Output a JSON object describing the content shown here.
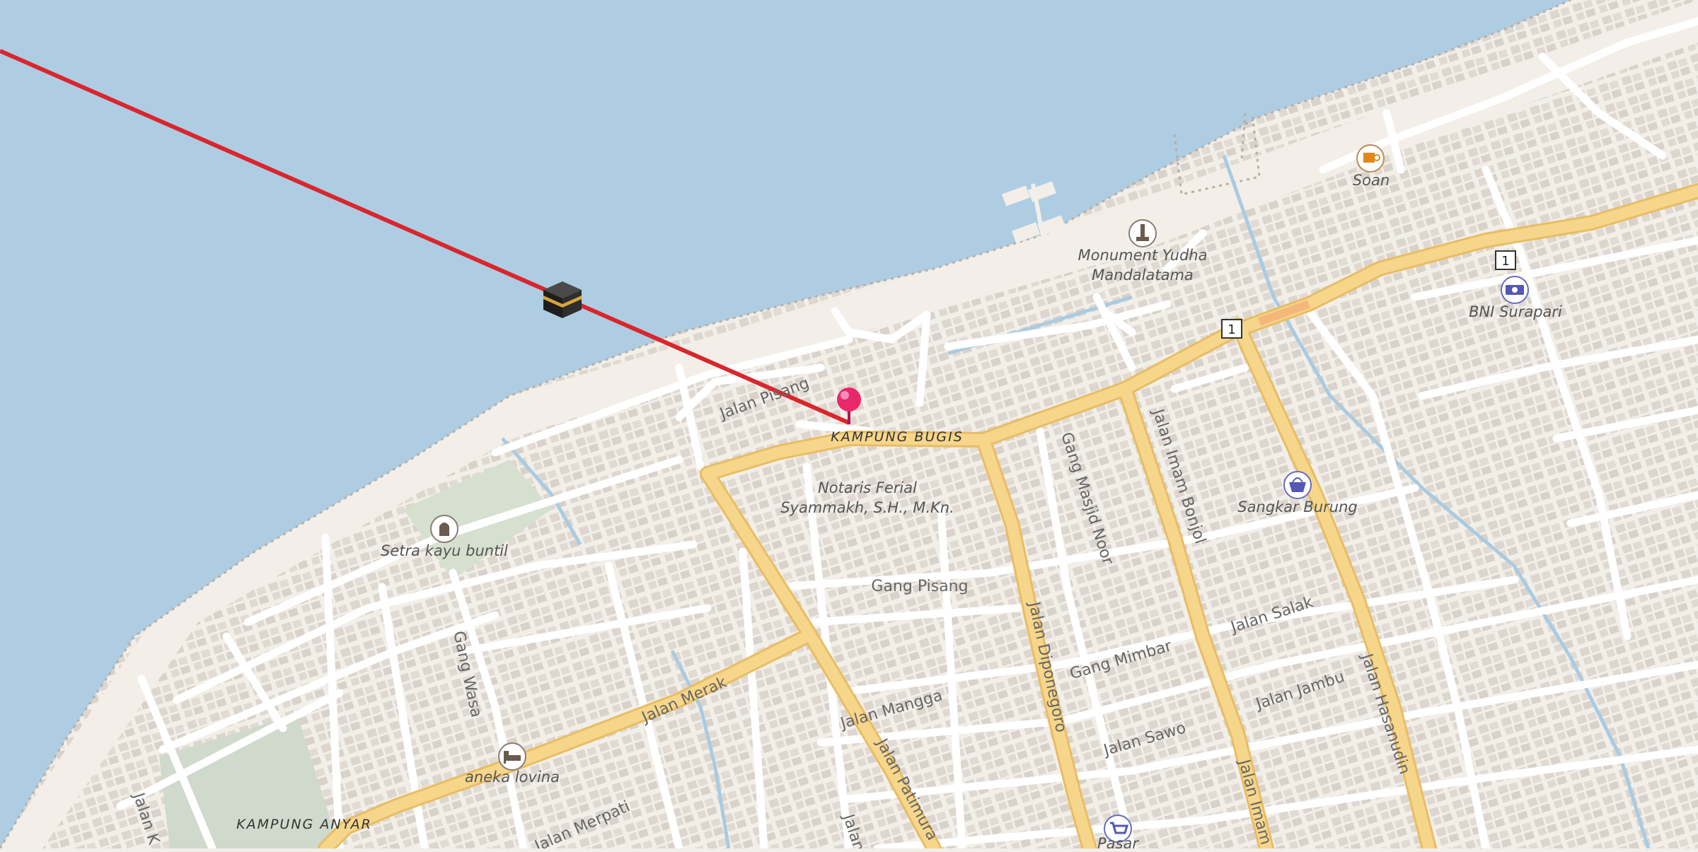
{
  "map": {
    "colors": {
      "water": "#aecde3",
      "land": "#f2efe9",
      "major_road": "#f6d68b",
      "major_road_casing": "#e8bd63",
      "minor_road": "#ffffff",
      "qibla_line": "#d9262d",
      "pin": "#e8286a"
    },
    "areas": {
      "kampung_bugis": "KAMPUNG BUGIS",
      "kampung_anyar": "KAMPUNG ANYAR"
    },
    "streets": {
      "jalan_pisang": "Jalan Pisang",
      "gang_pisang": "Gang Pisang",
      "gang_masjid_noor": "Gang Masjid Noor",
      "jalan_imam_bonjol": "Jalan Imam Bonjol",
      "jalan_imam_bonjol_2": "Jalan Imam B",
      "jalan_salak": "Jalan Salak",
      "gang_mimbar": "Gang Mimbar",
      "jalan_jambu": "Jalan Jambu",
      "jalan_hasanudin": "Jalan Hasanudin",
      "jalan_sawo": "Jalan Sawo",
      "jalan_mangga": "Jalan Mangga",
      "jalan_diponegoro": "Jalan Diponegoro",
      "jalan_patimura": "Jalan Patimura",
      "jalan_merak": "Jalan Merak",
      "jalan_merpati": "Jalan Merpati",
      "gang_wasa": "Gang Wasa",
      "jalan_k": "Jalan K",
      "jalan_partial": "Jalan"
    },
    "pois": {
      "notaris_line1": "Notaris Ferial",
      "notaris_line2": "Syammakh, S.H., M.Kn.",
      "setra": "Setra kayu buntil",
      "monument_line1": "Monument Yudha",
      "monument_line2": "Mandalatama",
      "soan": "Soan",
      "bni": "BNI Surapari",
      "sangkar": "Sangkar Burung",
      "aneka": "aneka lovina",
      "pasar": "Pasar"
    },
    "route_shields": {
      "a": "1",
      "b": "1"
    }
  }
}
